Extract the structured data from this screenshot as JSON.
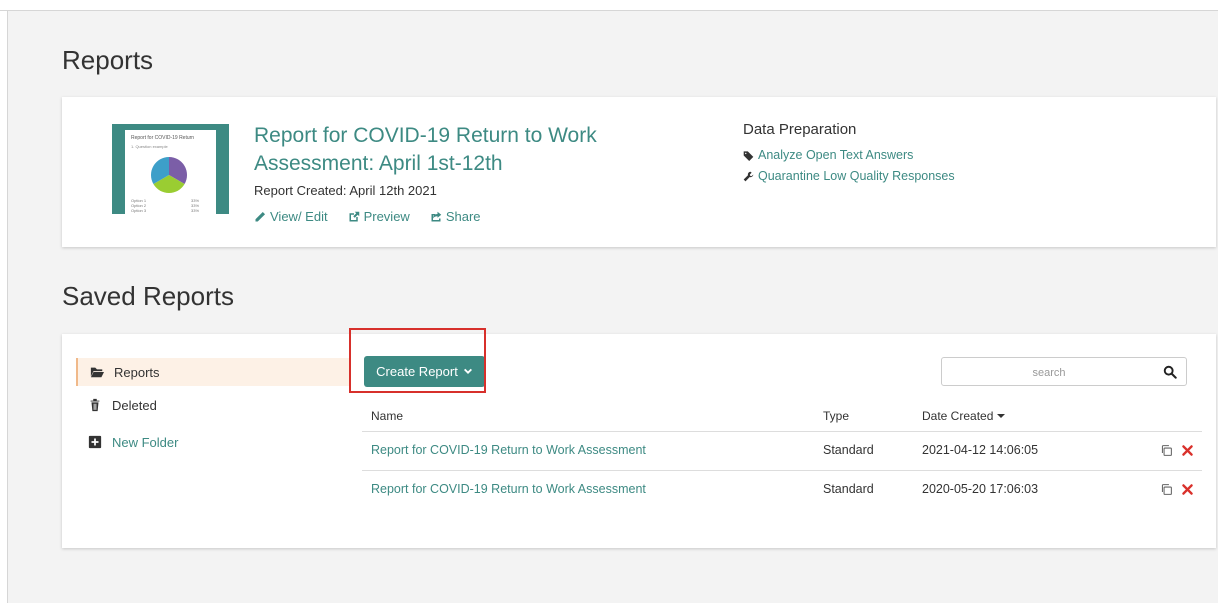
{
  "page": {
    "title": "Reports"
  },
  "report_card": {
    "thumbnail": {
      "title": "Report for COVID-19 Return",
      "subtitle": "1. Question example",
      "options": [
        "Option 1",
        "Option 2",
        "Option 3"
      ],
      "percents": [
        "33%",
        "33%",
        "33%"
      ],
      "pie_colors": [
        "#7b5ea7",
        "#9acd32",
        "#3d9fc9"
      ]
    },
    "name": "Report for COVID-19 Return to Work Assessment: April 1st-12th",
    "created": "Report Created: April 12th 2021",
    "actions": {
      "view_edit": "View/ Edit",
      "preview": "Preview",
      "share": "Share"
    },
    "data_prep": {
      "title": "Data Preparation",
      "analyze": "Analyze Open Text Answers",
      "quarantine": "Quarantine Low Quality Responses"
    }
  },
  "saved": {
    "title": "Saved Reports",
    "sidebar": {
      "reports": "Reports",
      "deleted": "Deleted",
      "new_folder": "New Folder"
    },
    "create_button": "Create Report",
    "search": {
      "placeholder": "search"
    },
    "table": {
      "headers": {
        "name": "Name",
        "type": "Type",
        "date": "Date Created"
      },
      "rows": [
        {
          "name": "Report for COVID-19 Return to Work Assessment",
          "type": "Standard",
          "date": "2021-04-12 14:06:05"
        },
        {
          "name": "Report for COVID-19 Return to Work Assessment",
          "type": "Standard",
          "date": "2020-05-20 17:06:03"
        }
      ]
    }
  },
  "colors": {
    "brand": "#3d8a83",
    "highlight": "#d7302b",
    "delete": "#d9302b",
    "active_bg": "#fdf1e6"
  }
}
